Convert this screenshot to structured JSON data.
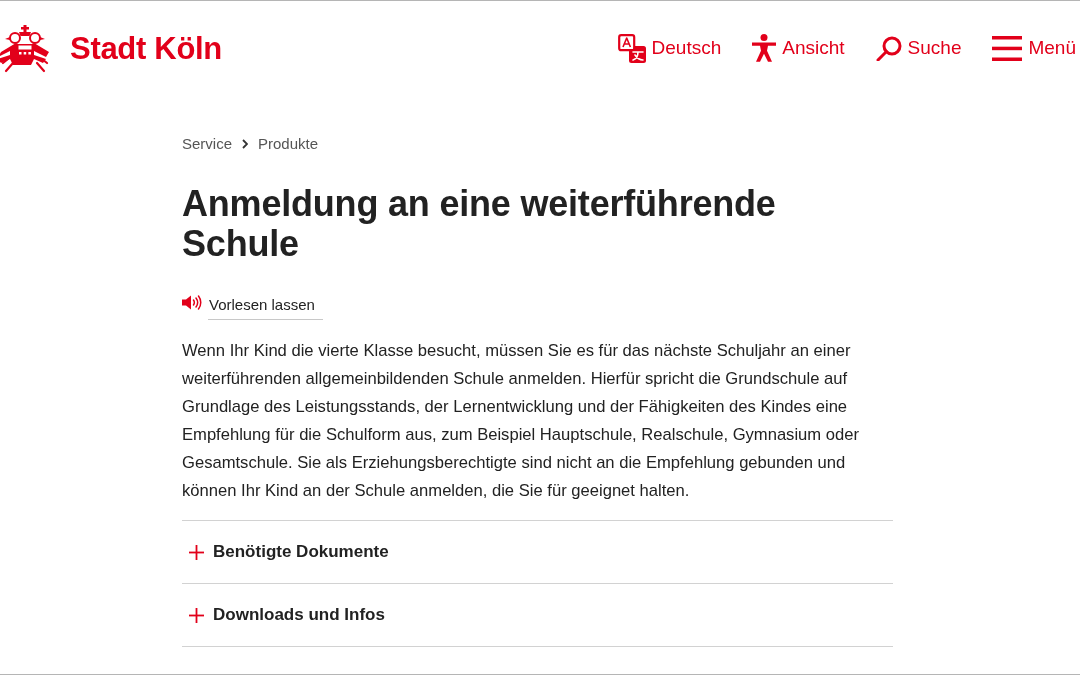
{
  "header": {
    "site_name": "Stadt Köln",
    "nav": [
      {
        "kind": "language",
        "label": "Deutsch"
      },
      {
        "kind": "view",
        "label": "Ansicht"
      },
      {
        "kind": "search",
        "label": "Suche"
      },
      {
        "kind": "menu",
        "label": "Menü"
      }
    ]
  },
  "breadcrumb": [
    {
      "label": "Service"
    },
    {
      "label": "Produkte"
    }
  ],
  "title": "Anmeldung an eine weiterführende Schule",
  "read_aloud": {
    "label": "Vorlesen lassen"
  },
  "intro": "Wenn Ihr Kind die vierte Klasse besucht, müssen Sie es für das nächste Schuljahr an einer weiterführenden allgemeinbildenden Schule anmelden. Hierfür spricht die Grundschule auf Grundlage des Leistungsstands, der Lernentwicklung und der Fähigkeiten des Kindes eine Empfehlung für die Schulform aus, zum Beispiel Hauptschule, Realschule, Gymnasium oder Gesamtschule. Sie als Erziehungsberechtigte sind nicht an die Empfehlung gebunden und können Ihr Kind an der Schule anmelden, die Sie für geeignet halten.",
  "accordion": [
    {
      "label": "Benötigte Dokumente",
      "expanded": false
    },
    {
      "label": "Downloads und Infos",
      "expanded": false
    }
  ]
}
